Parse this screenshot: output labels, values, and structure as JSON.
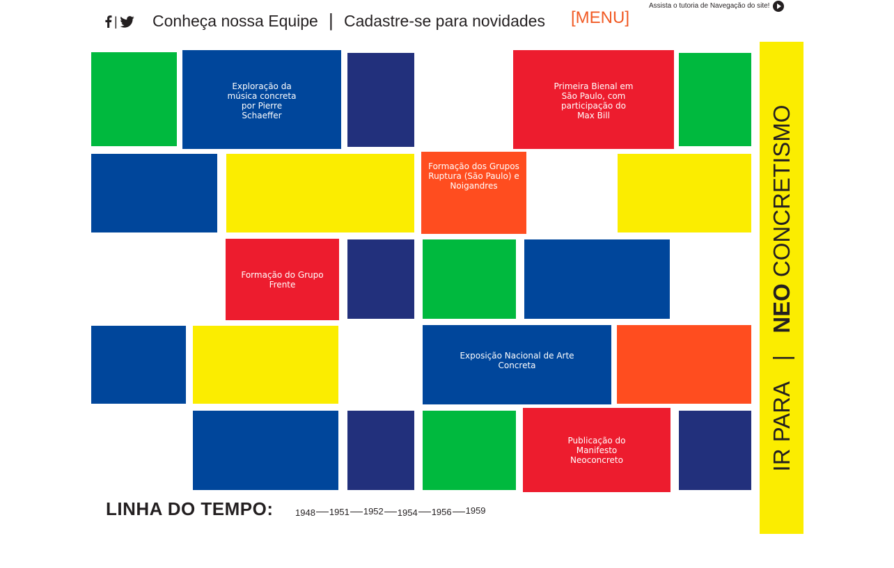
{
  "header": {
    "social": {
      "facebook_icon": "facebook-icon",
      "separator": "|",
      "twitter_icon": "twitter-icon"
    },
    "links": [
      "Conheça nossa Equipe",
      "Cadastre-se para novidades"
    ],
    "separator": "|",
    "menu_label": "[MENU]",
    "tutorial_text": "Assista o tutoria de Navegação do site!",
    "tutorial_icon": "play-circle-icon"
  },
  "colors": {
    "green": "#00b93e",
    "blue": "#00469b",
    "navy": "#22307c",
    "red": "#ed1c2e",
    "yellow": "#fbed00",
    "orange": "#ff4d1f"
  },
  "tiles": [
    {
      "color": "green"
    },
    {
      "color": "blue",
      "label": "Exploração da música concreta por Pierre Schaeffer"
    },
    {
      "color": "navy"
    },
    {
      "color": "red",
      "label": "Primeira Bienal em São Paulo, com participação do Max Bill"
    },
    {
      "color": "green"
    },
    {
      "color": "blue"
    },
    {
      "color": "yellow"
    },
    {
      "color": "orange",
      "label": "Formação dos Grupos Ruptura (São Paulo) e Noigandres"
    },
    {
      "color": "yellow"
    },
    {
      "color": "red",
      "label": "Formação do Grupo Frente"
    },
    {
      "color": "navy"
    },
    {
      "color": "green"
    },
    {
      "color": "blue"
    },
    {
      "color": "blue"
    },
    {
      "color": "yellow"
    },
    {
      "color": "blue",
      "label": "Exposição Nacional de Arte Concreta"
    },
    {
      "color": "orange"
    },
    {
      "color": "blue"
    },
    {
      "color": "navy"
    },
    {
      "color": "green"
    },
    {
      "color": "red",
      "label": "Publicação do Manifesto Neoconcreto"
    },
    {
      "color": "navy"
    }
  ],
  "sidebar": {
    "part1": "IR PARA",
    "separator": "|",
    "part2": "NEO",
    "part3": "CONCRETISMO"
  },
  "timeline": {
    "title": "LINHA DO TEMPO:",
    "years": [
      "1948",
      "1951",
      "1952",
      "1954",
      "1956",
      "1959"
    ]
  }
}
